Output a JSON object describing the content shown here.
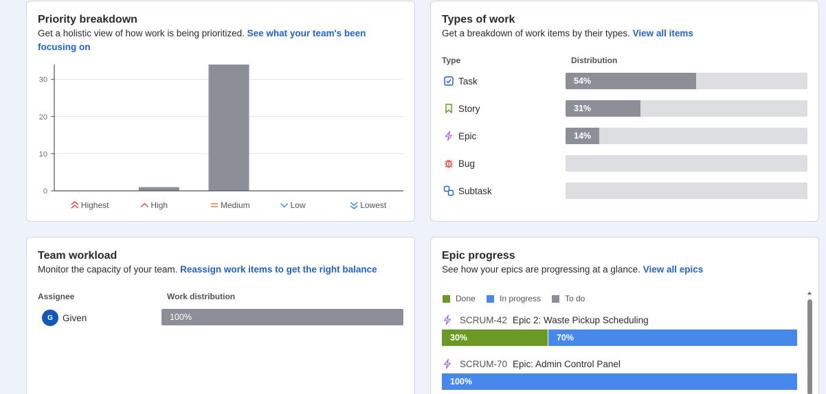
{
  "priority": {
    "title": "Priority breakdown",
    "desc": "Get a holistic view of how work is being prioritized.",
    "link": "See what your team's been focusing on",
    "chart_data": {
      "type": "bar",
      "categories": [
        "Highest",
        "High",
        "Medium",
        "Low",
        "Lowest"
      ],
      "values": [
        0,
        1,
        34,
        0,
        0
      ],
      "ylim": [
        0,
        34
      ],
      "yticks": [
        0,
        10,
        20,
        30
      ],
      "colors": {
        "bar": "#8c8f97",
        "highest": "#e5493a",
        "high": "#e5493a",
        "medium": "#e97f33",
        "low": "#2d8fe3",
        "lowest": "#2d8fe3"
      }
    },
    "icons": [
      "chevron-double-up-icon",
      "chevron-up-icon",
      "equals-icon",
      "chevron-down-icon",
      "chevron-double-down-icon"
    ]
  },
  "types": {
    "title": "Types of work",
    "desc": "Get a breakdown of work items by their types.",
    "link": "View all items",
    "col_type": "Type",
    "col_dist": "Distribution",
    "rows": [
      {
        "label": "Task",
        "pct": "54%",
        "value": 54,
        "icon": "task-checkbox-icon"
      },
      {
        "label": "Story",
        "pct": "31%",
        "value": 31,
        "icon": "story-bookmark-icon"
      },
      {
        "label": "Epic",
        "pct": "14%",
        "value": 14,
        "icon": "epic-bolt-icon"
      },
      {
        "label": "Bug",
        "pct": "",
        "value": 0,
        "icon": "bug-icon"
      },
      {
        "label": "Subtask",
        "pct": "",
        "value": 0,
        "icon": "subtask-icon"
      }
    ]
  },
  "workload": {
    "title": "Team workload",
    "desc": "Monitor the capacity of your team.",
    "link": "Reassign work items to get the right balance",
    "col_assignee": "Assignee",
    "col_dist": "Work distribution",
    "rows": [
      {
        "avatar": "G",
        "name": "Given",
        "pct": "100%",
        "value": 100
      }
    ]
  },
  "epics": {
    "title": "Epic progress",
    "desc": "See how your epics are progressing at a glance.",
    "link": "View all epics",
    "legend": {
      "done": "Done",
      "in_progress": "In progress",
      "todo": "To do"
    },
    "colors": {
      "done": "#6a9a23",
      "in_progress": "#4688ec",
      "todo": "#8c8f97"
    },
    "items": [
      {
        "key": "SCRUM-42",
        "name": "Epic 2: Waste Pickup Scheduling",
        "done": 30,
        "done_label": "30%",
        "progress": 70,
        "progress_label": "70%"
      },
      {
        "key": "SCRUM-70",
        "name": "Epic: Admin Control Panel",
        "done": 0,
        "done_label": "",
        "progress": 100,
        "progress_label": "100%"
      }
    ]
  }
}
